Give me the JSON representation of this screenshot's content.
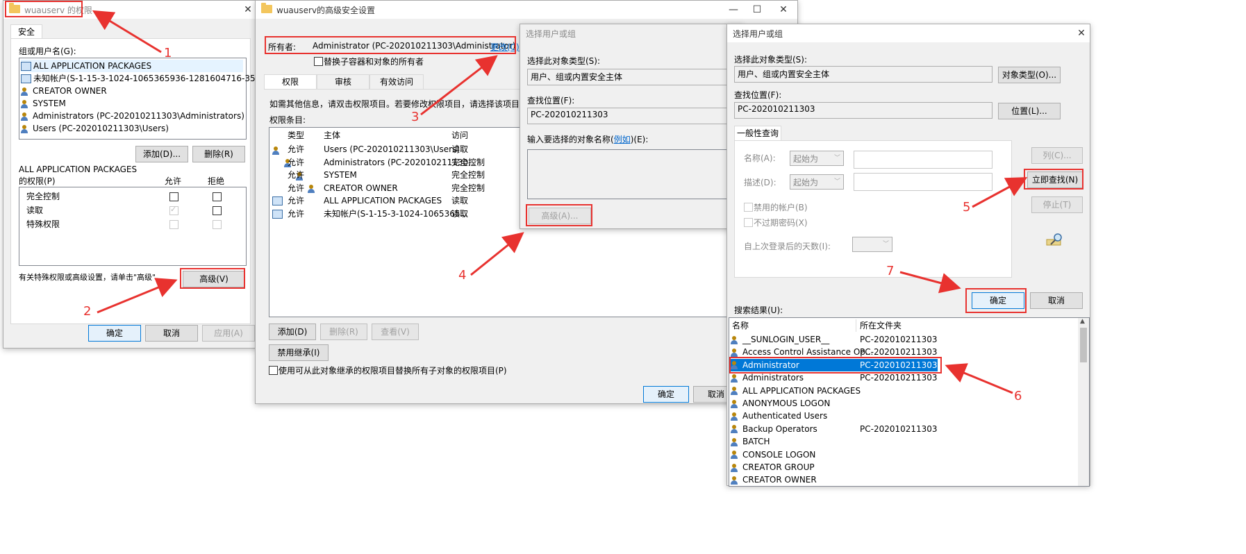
{
  "perm_window": {
    "title": "wuauserv 的权限",
    "tab_security": "安全",
    "group_label": "组或用户名(G):",
    "principals": [
      "ALL APPLICATION PACKAGES",
      "未知帐户(S-1-15-3-1024-1065365936-1281604716-351173...",
      "CREATOR OWNER",
      "SYSTEM",
      "Administrators (PC-202010211303\\Administrators)",
      "Users (PC-202010211303\\Users)"
    ],
    "add_label": "添加(D)...",
    "remove_label": "删除(R)",
    "perm_for_line1": "ALL APPLICATION PACKAGES",
    "perm_for_line2": "的权限(P)",
    "allow_header": "允许",
    "deny_header": "拒绝",
    "perm_rows": [
      "完全控制",
      "读取",
      "特殊权限"
    ],
    "advanced_hint": "有关特殊权限或高级设置，请单击\"高级\"。",
    "advanced_label": "高级(V)",
    "ok_label": "确定",
    "cancel_label": "取消",
    "apply_label": "应用(A)"
  },
  "adv_window": {
    "title": "wuauserv的高级安全设置",
    "owner_label": "所有者:",
    "owner_value": "Administrator (PC-202010211303\\Administrator)",
    "change_link": "更改(C)",
    "replace_owner": "替换子容器和对象的所有者",
    "tabs": [
      "权限",
      "审核",
      "有效访问"
    ],
    "info_text": "如需其他信息，请双击权限项目。若要修改权限项目，请选择该项目并单",
    "entries_label": "权限条目:",
    "col_type": "类型",
    "col_principal": "主体",
    "col_access": "访问",
    "entries": [
      {
        "type": "允许",
        "principal": "Users (PC-202010211303\\Users)",
        "access": "读取"
      },
      {
        "type": "允许",
        "principal": "Administrators (PC-202010211130...",
        "access": "完全控制"
      },
      {
        "type": "允许",
        "principal": "SYSTEM",
        "access": "完全控制"
      },
      {
        "type": "允许",
        "principal": "CREATOR OWNER",
        "access": "完全控制"
      },
      {
        "type": "允许",
        "principal": "ALL APPLICATION PACKAGES",
        "access": "读取"
      },
      {
        "type": "允许",
        "principal": "未知帐户(S-1-15-3-1024-1065365...",
        "access": "读取"
      }
    ],
    "add_label": "添加(D)",
    "remove_label": "删除(R)",
    "view_label": "查看(V)",
    "disable_inherit_label": "禁用继承(I)",
    "replace_child_label": "使用可从此对象继承的权限项目替换所有子对象的权限项目(P)",
    "ok_label": "确定",
    "cancel_label": "取消"
  },
  "sel_window_small": {
    "title": "选择用户或组",
    "obj_type_label": "选择此对象类型(S):",
    "obj_type_value": "用户、组或内置安全主体",
    "location_label": "查找位置(F):",
    "location_value": "PC-202010211303",
    "enter_label_pre": "输入要选择的对象名称(",
    "enter_label_link": "例如",
    "enter_label_post": ")(E):",
    "advanced_label": "高级(A)..."
  },
  "sel_window_adv": {
    "title": "选择用户或组",
    "obj_type_label": "选择此对象类型(S):",
    "obj_type_value": "用户、组或内置安全主体",
    "obj_type_btn": "对象类型(O)...",
    "location_label": "查找位置(F):",
    "location_value": "PC-202010211303",
    "location_btn": "位置(L)...",
    "query_tab": "一般性查询",
    "name_label": "名称(A):",
    "desc_label": "描述(D):",
    "starts_with": "起始为",
    "disabled_accounts": "禁用的帐户(B)",
    "non_expiring": "不过期密码(X)",
    "days_since_login": "自上次登录后的天数(I):",
    "columns_btn": "列(C)...",
    "find_now_btn": "立即查找(N)",
    "stop_btn": "停止(T)",
    "ok_label": "确定",
    "cancel_label": "取消",
    "results_label": "搜索结果(U):",
    "col_name": "名称",
    "col_folder": "所在文件夹",
    "results": [
      {
        "name": "__SUNLOGIN_USER__",
        "folder": "PC-202010211303"
      },
      {
        "name": "Access Control Assistance Op...",
        "folder": "PC-202010211303"
      },
      {
        "name": "Administrator",
        "folder": "PC-202010211303"
      },
      {
        "name": "Administrators",
        "folder": "PC-202010211303"
      },
      {
        "name": "ALL APPLICATION PACKAGES",
        "folder": ""
      },
      {
        "name": "ANONYMOUS LOGON",
        "folder": ""
      },
      {
        "name": "Authenticated Users",
        "folder": ""
      },
      {
        "name": "Backup Operators",
        "folder": "PC-202010211303"
      },
      {
        "name": "BATCH",
        "folder": ""
      },
      {
        "name": "CONSOLE LOGON",
        "folder": ""
      },
      {
        "name": "CREATOR GROUP",
        "folder": ""
      },
      {
        "name": "CREATOR OWNER",
        "folder": ""
      }
    ]
  },
  "annotations": [
    "1",
    "2",
    "3",
    "4",
    "5",
    "6",
    "7"
  ],
  "colors": {
    "annotation_red": "#e8322f",
    "selection_blue": "#0078d7"
  }
}
